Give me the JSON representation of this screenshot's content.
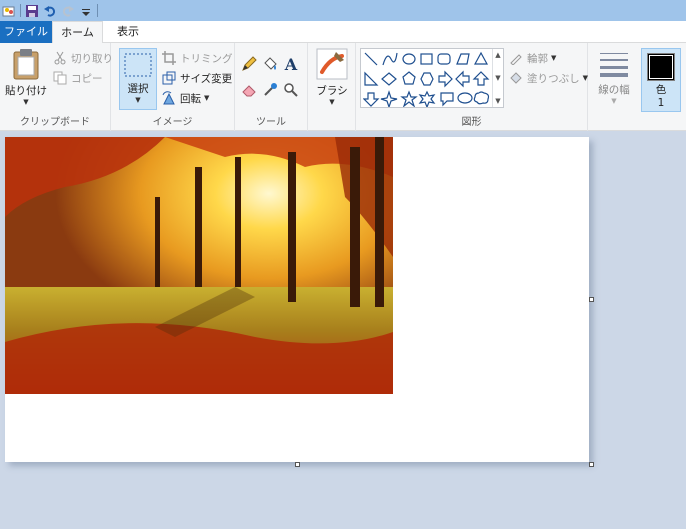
{
  "qat": {
    "icons": [
      "app-icon",
      "save-icon",
      "undo-icon",
      "redo-icon",
      "customize-dropdown-icon"
    ]
  },
  "tabs": {
    "file": "ファイル",
    "home": "ホーム",
    "view": "表示"
  },
  "clipboard": {
    "paste": "貼り付け",
    "cut": "切り取り",
    "copy": "コピー",
    "label": "クリップボード"
  },
  "image": {
    "select": "選択",
    "crop": "トリミング",
    "resize": "サイズ変更",
    "rotate": "回転",
    "label": "イメージ"
  },
  "tools": {
    "label": "ツール"
  },
  "brushes": {
    "label": "ブラシ"
  },
  "shapes": {
    "outline": "輪郭",
    "fill": "塗りつぶし",
    "label": "図形"
  },
  "size": {
    "label": "線の幅"
  },
  "color": {
    "label": "色",
    "number": "1",
    "value": "#000000"
  },
  "canvas": {
    "image": "autumn-forest-photo"
  }
}
